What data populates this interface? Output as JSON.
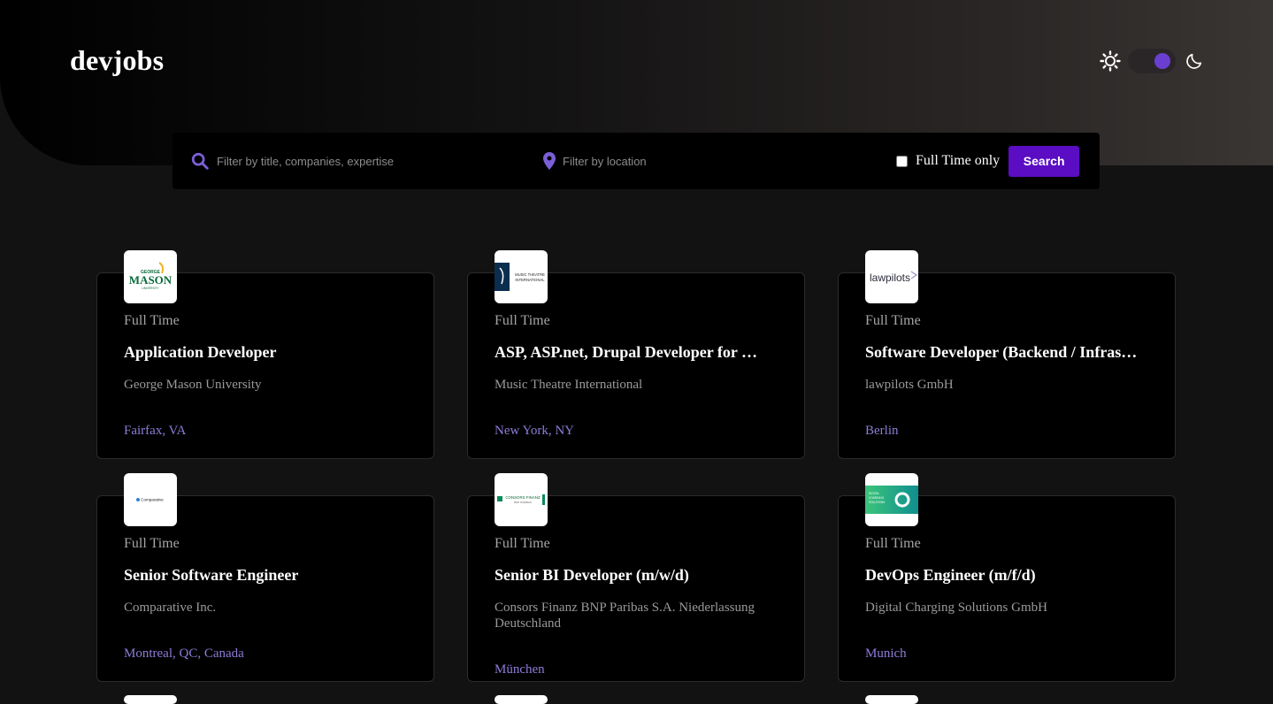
{
  "app": {
    "title": "devjobs"
  },
  "search": {
    "title_placeholder": "Filter by title, companies, expertise",
    "location_placeholder": "Filter by location",
    "fulltime_label": "Full Time only",
    "button_label": "Search"
  },
  "colors": {
    "accent": "#5a0dc2",
    "location": "#8f7cd9",
    "toggle_knob": "#6a3fd0"
  },
  "jobs": [
    {
      "type": "Full Time",
      "title": "Application Developer",
      "company": "George Mason University",
      "location": "Fairfax, VA",
      "logo_text_1": "GEORGE",
      "logo_text_2": "MASON",
      "logo_text_3": "UNIVERSITY"
    },
    {
      "type": "Full Time",
      "title": "ASP, ASP.net, Drupal Developer for …",
      "company": "Music Theatre International",
      "location": "New York, NY",
      "logo_text_1": "MUSIC THEATRE",
      "logo_text_2": "INTERNATIONAL"
    },
    {
      "type": "Full Time",
      "title": "Software Developer (Backend / Infras…",
      "company": "lawpilots GmbH",
      "location": "Berlin",
      "logo_text_1": "lawpilots"
    },
    {
      "type": "Full Time",
      "title": "Senior Software Engineer",
      "company": "Comparative Inc.",
      "location": "Montreal, QC, Canada",
      "logo_text_1": "Comparative"
    },
    {
      "type": "Full Time",
      "title": "Senior BI Developer (m/w/d)",
      "company": "Consors Finanz BNP Paribas S.A. Niederlassung Deutschland",
      "location": "München",
      "logo_text_1": "CONSORS FINANZ",
      "logo_text_2": "BNP PARIBAS"
    },
    {
      "type": "Full Time",
      "title": "DevOps Engineer (m/f/d)",
      "company": "Digital Charging Solutions GmbH",
      "location": "Munich",
      "logo_text_1": "DIGITAL",
      "logo_text_2": "CHARGING",
      "logo_text_3": "SOLUTIONS"
    }
  ]
}
